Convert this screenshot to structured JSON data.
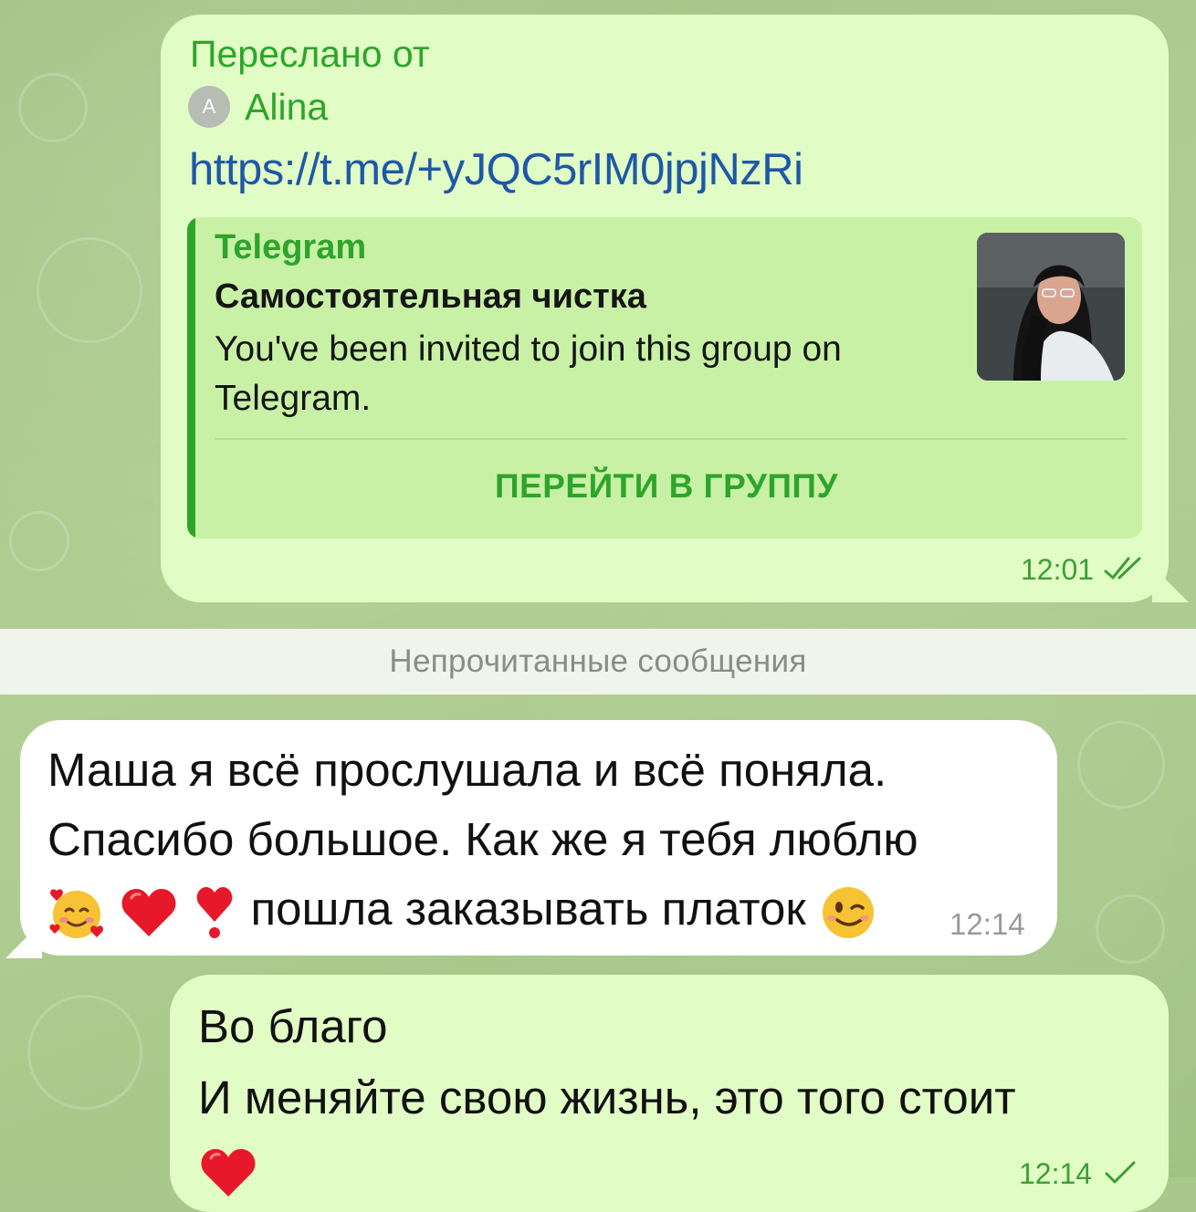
{
  "forwarded_message": {
    "forwarded_label": "Переслано от",
    "sender_initial": "A",
    "sender_name": "Alina",
    "link": "https://t.me/+yJQC5rIM0jpjNzRi",
    "preview": {
      "site_name": "Telegram",
      "title": "Самостоятельная чистка",
      "description": "You've been invited to join this group on Telegram.",
      "button_label": "ПЕРЕЙТИ В ГРУППУ"
    },
    "time": "12:01",
    "status": "read"
  },
  "unread_divider": "Непрочитанные сообщения",
  "incoming_message": {
    "line1": "Маша я всё прослушала и всё поняла.",
    "line2": "Спасибо большое. Как же я тебя люблю",
    "line3_text": "пошла заказывать платок",
    "emojis": [
      "smiling-face-with-hearts",
      "red-heart",
      "heart-exclamation",
      "winking-face"
    ],
    "time": "12:14"
  },
  "outgoing_message": {
    "line1": "Во благо",
    "line2": "И меняйте свою жизнь, это того стоит",
    "emoji": "red-heart",
    "time": "12:14",
    "status": "sent"
  },
  "colors": {
    "outgoing_bubble": "#e1fdc5",
    "incoming_bubble": "#ffffff",
    "accent_green": "#2ea52a",
    "link_blue": "#1f57a8",
    "wallpaper": "#a9c98c"
  }
}
